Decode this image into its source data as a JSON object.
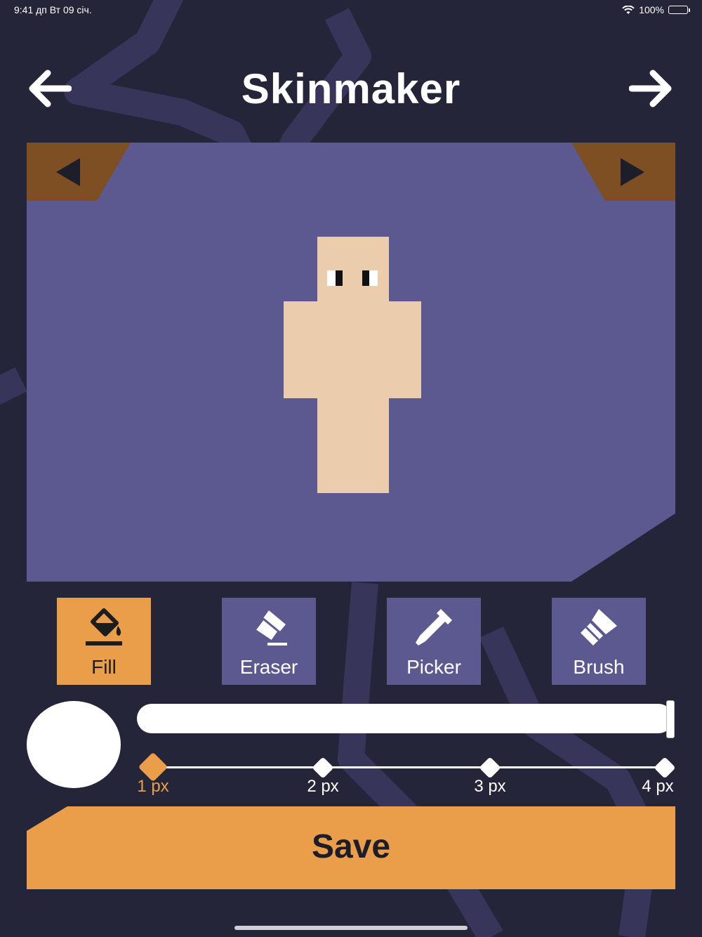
{
  "status_bar": {
    "time_date": "9:41 дп   Вт 09 січ.",
    "battery": "100%"
  },
  "header": {
    "title": "Skinmaker",
    "back_icon": "arrow-left-icon",
    "forward_icon": "arrow-right-icon"
  },
  "canvas": {
    "background": "#5b5990",
    "corner_color": "#7d4f22",
    "prev_icon": "triangle-left-icon",
    "next_icon": "triangle-right-icon",
    "skin_color": "#ebcdad"
  },
  "tools": [
    {
      "label": "Fill",
      "icon": "paint-bucket-icon",
      "active": true
    },
    {
      "label": "Eraser",
      "icon": "eraser-icon",
      "active": false
    },
    {
      "label": "Picker",
      "icon": "eyedropper-icon",
      "active": false
    },
    {
      "label": "Brush",
      "icon": "brush-icon",
      "active": false
    }
  ],
  "color": {
    "current": "#ffffff",
    "slider_value": 1.0
  },
  "brush_sizes": {
    "options": [
      "1 px",
      "2 px",
      "3 px",
      "4 px"
    ],
    "selected": "1 px"
  },
  "save_label": "Save",
  "colors": {
    "accent": "#eb9e4a",
    "panel": "#5b5990",
    "background": "#25253a"
  }
}
